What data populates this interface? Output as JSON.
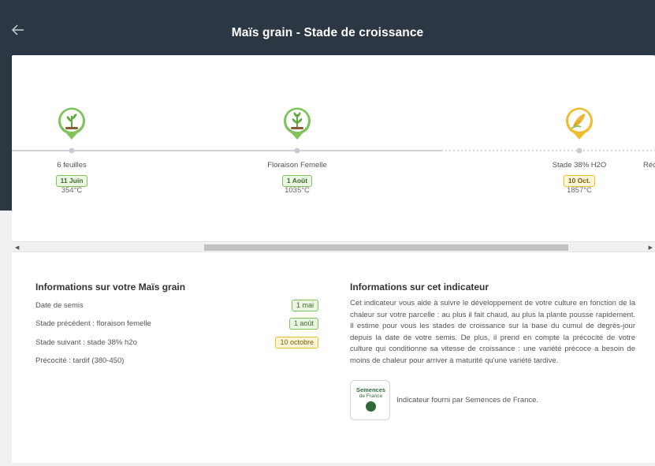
{
  "header": {
    "title": "Maïs grain - Stade de croissance",
    "back_icon": "arrow-left-icon"
  },
  "timeline": {
    "stages": [
      {
        "name": "6 feuilles",
        "date": "11 Juin",
        "temp": "354°C",
        "status": "done",
        "icon": "plant-seedling-icon"
      },
      {
        "name": "Floraison Femelle",
        "date": "1 Août",
        "temp": "1035°C",
        "status": "done",
        "icon": "plant-flowering-icon"
      },
      {
        "name": "Stade 38% H2O",
        "date": "10 Oct.",
        "temp": "1857°C",
        "status": "upcoming",
        "icon": "corn-cob-icon"
      }
    ],
    "partial_next_label": "Réc",
    "colors": {
      "done": "#7fc35a",
      "upcoming": "#f0bc2a"
    }
  },
  "info_crop": {
    "title": "Informations sur votre Maïs grain",
    "rows": [
      {
        "label": "Date de semis",
        "value": "1 mai",
        "style": "green"
      },
      {
        "label": "Stade précédent : floraison femelle",
        "value": "1 août",
        "style": "green"
      },
      {
        "label": "Stade suivant : stade 38% h2o",
        "value": "10 octobre",
        "style": "yellow"
      },
      {
        "label": "Précocité : tardif (380-450)",
        "value": null,
        "style": null
      }
    ]
  },
  "info_indicator": {
    "title": "Informations sur cet indicateur",
    "description": "Cet indicateur vous aide à suivre le développement de votre culture en fonction de la chaleur sur votre parcelle : au plus il fait chaud, au plus la plante pousse rapidement. Il estime pour vous les stades de croissance sur la base du cumul de degrés-jour depuis la date de votre semis. De plus, il prend en compte la précocité de votre culture qui conditionne sa vitesse de croissance : une variété précoce a besoin de moins de chaleur pour arriver à maturité qu'une variété tardive.",
    "logo_line1": "Semences",
    "logo_line2": "de France",
    "provider": "Indicateur fourni par Semences de France."
  }
}
